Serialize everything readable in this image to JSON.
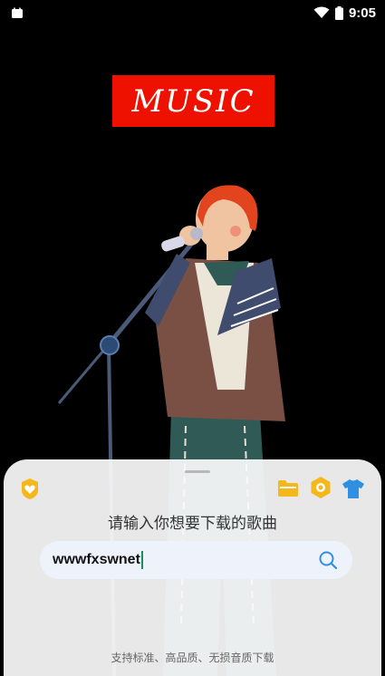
{
  "status_bar": {
    "time": "9:05"
  },
  "logo": {
    "text": "MUSIC",
    "background": "#ee1100"
  },
  "sheet": {
    "top_icons": [
      "heart-badge-icon",
      "folder-icon",
      "hexagon-badge-icon",
      "tshirt-icon"
    ],
    "title": "请输入你想要下载的歌曲",
    "search": {
      "value": "wwwfxswnet",
      "placeholder": ""
    },
    "footer": "支持标准、高品质、无损音质下载"
  },
  "colors": {
    "accent_yellow": "#f5b81c",
    "accent_blue": "#2f8fe0",
    "search_bg": "#eef3fb"
  }
}
